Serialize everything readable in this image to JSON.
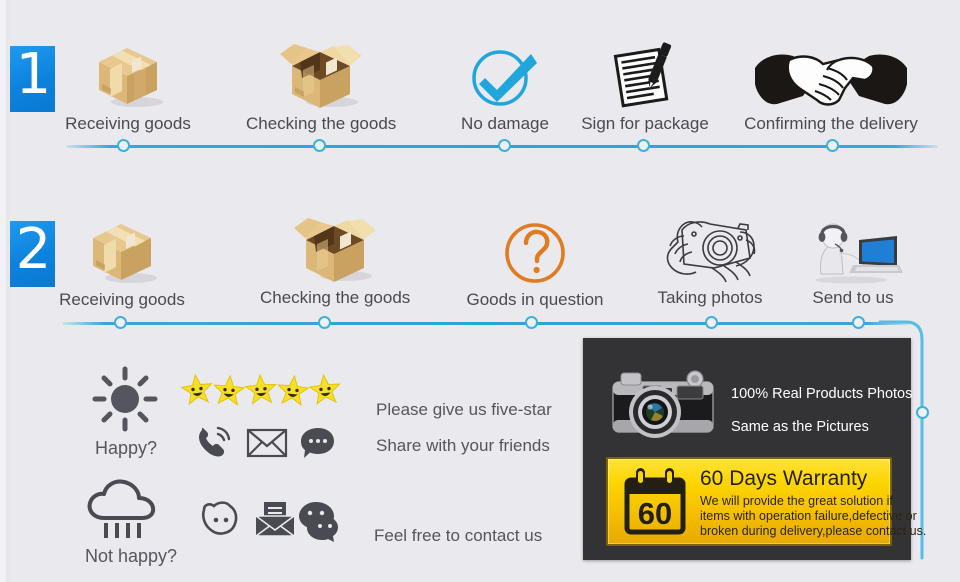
{
  "page": {
    "background_color": "#eae9ed",
    "accent_blue": "#2ba3d4",
    "badge_blue": "#0f86e0",
    "warranty_yellow": "#fdd500",
    "panel_dark": "#333335",
    "question_orange": "#e07b22"
  },
  "sections": [
    {
      "badge": "1",
      "steps": [
        {
          "label": "Receiving goods",
          "icon": "closed-box-icon"
        },
        {
          "label": "Checking the goods",
          "icon": "open-box-icon"
        },
        {
          "label": "No damage",
          "icon": "check-circle-icon"
        },
        {
          "label": "Sign for package",
          "icon": "signing-document-icon"
        },
        {
          "label": "Confirming the delivery",
          "icon": "handshake-icon"
        }
      ]
    },
    {
      "badge": "2",
      "steps": [
        {
          "label": "Receiving goods",
          "icon": "closed-box-icon"
        },
        {
          "label": "Checking the goods",
          "icon": "open-box-icon"
        },
        {
          "label": "Goods in question",
          "icon": "question-mark-circle-icon"
        },
        {
          "label": "Taking photos",
          "icon": "hands-camera-icon"
        },
        {
          "label": "Send to us",
          "icon": "support-agent-laptop-icon"
        }
      ]
    }
  ],
  "feedback": {
    "happy": {
      "mood_label": "Happy?",
      "mood_icon": "sun-icon",
      "stars_count": 5,
      "star_icon": "smiling-star-icon",
      "contact_icons": [
        "phone-ringing-icon",
        "envelope-icon",
        "chat-bubble-icon"
      ],
      "line1": "Please give us five-star",
      "line2": "Share with your friends"
    },
    "not_happy": {
      "mood_label": "Not happy?",
      "mood_icon": "rain-cloud-icon",
      "contact_icons": [
        "smiley-face-icon",
        "open-envelope-letter-icon",
        "wechat-icon"
      ],
      "line1": "Feel free to contact us"
    }
  },
  "photo_panel": {
    "camera_icon": "vintage-camera-icon",
    "line1": "100% Real Products Photos",
    "line2": "Same as the Pictures"
  },
  "warranty": {
    "calendar_icon": "calendar-60-icon",
    "calendar_number": "60",
    "title": "60 Days Warranty",
    "body_line1": "We will provide the great solution if",
    "body_line2": "items with operation failure,defective or",
    "body_line3": "broken during delivery,please contact us."
  }
}
